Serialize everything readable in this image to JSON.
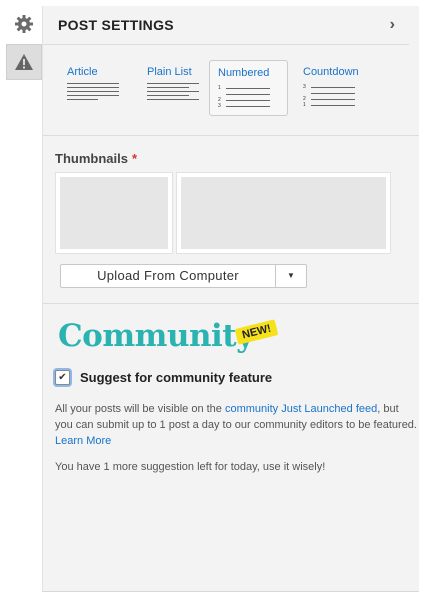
{
  "panel": {
    "title": "POST SETTINGS"
  },
  "styles": [
    {
      "label": "Article"
    },
    {
      "label": "Plain List"
    },
    {
      "label": "Numbered"
    },
    {
      "label": "Countdown"
    }
  ],
  "selected_style": "Numbered",
  "numbered_digits": [
    "1",
    "2",
    "3"
  ],
  "countdown_digits": [
    "3",
    "2",
    "1"
  ],
  "thumbnails": {
    "title": "Thumbnails",
    "required_mark": "*"
  },
  "upload": {
    "label": "Upload From Computer",
    "dropdown_glyph": "▼"
  },
  "community": {
    "wordmark": "Community",
    "badge": "NEW!",
    "checkbox_label": "Suggest for community feature",
    "checked": true,
    "desc_prefix": "All your posts will be visible on the ",
    "desc_link": "community Just Launched feed",
    "desc_mid": ", but you can submit up to 1 post a day to our community editors to be featured. ",
    "desc_link2": "Learn More",
    "remaining": "You have 1 more suggestion left for today, use it wisely!"
  },
  "icons": {
    "settings": "gear-icon",
    "warning": "warning-icon"
  },
  "colors": {
    "accent": "#1a73c9",
    "community": "#2bb3b1",
    "badge": "#f6e11b",
    "required": "#d9342b"
  }
}
